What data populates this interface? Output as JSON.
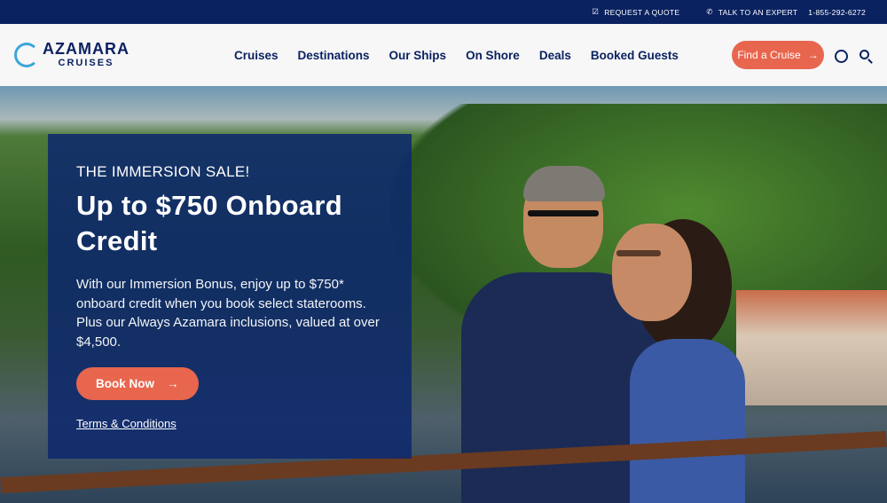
{
  "topbar": {
    "request_quote": "REQUEST A QUOTE",
    "talk_expert": "TALK TO AN EXPERT",
    "phone": "1-855-292-6272"
  },
  "logo": {
    "line1": "AZAMARA",
    "line2": "CRUISES"
  },
  "nav": {
    "items": [
      "Cruises",
      "Destinations",
      "Our Ships",
      "On Shore",
      "Deals",
      "Booked Guests"
    ],
    "find_cruise": "Find a Cruise"
  },
  "hero": {
    "eyebrow": "THE IMMERSION SALE!",
    "title": "Up to $750 Onboard Credit",
    "body": "With our Immersion Bonus, enjoy up to $750* onboard credit when you book select staterooms. Plus our Always Azamara inclusions, valued at over $4,500.",
    "cta": "Book Now",
    "terms": "Terms & Conditions"
  },
  "colors": {
    "navy": "#0b2260",
    "coral": "#e8664e"
  }
}
